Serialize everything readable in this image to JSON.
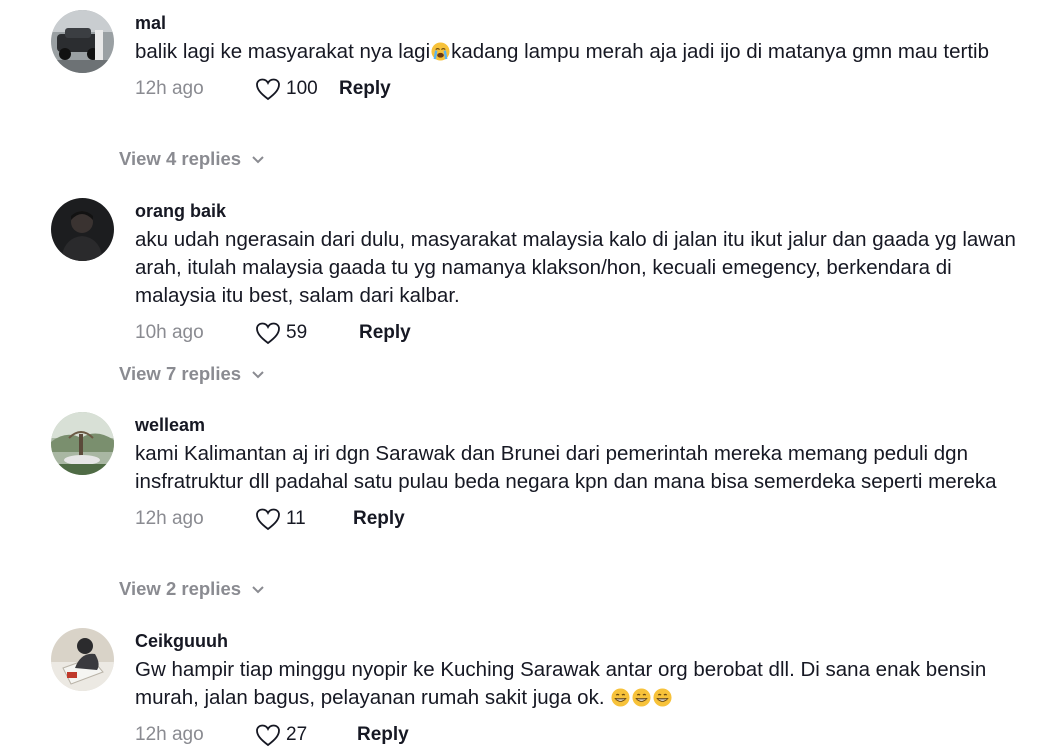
{
  "comments": [
    {
      "username": "mal",
      "text_before": "balik lagi ke masyarakat nya lagi",
      "emoji_inline": "loudly-crying-face",
      "text_after": "kadang lampu merah aja jadi ijo di matanya gmn mau tertib",
      "time": "12h ago",
      "likes": "100",
      "reply_label": "Reply",
      "view_replies": "View 4 replies"
    },
    {
      "username": "orang baik",
      "text": "aku udah ngerasain dari dulu, masyarakat malaysia kalo di jalan itu ikut jalur dan gaada yg lawan arah, itulah malaysia gaada tu yg namanya klakson/hon, kecuali emegency, berkendara di malaysia itu best, salam dari kalbar.",
      "time": "10h ago",
      "likes": "59",
      "reply_label": "Reply",
      "view_replies": "View 7 replies"
    },
    {
      "username": "welleam",
      "text": "kami Kalimantan aj iri dgn Sarawak dan Brunei dari pemerintah mereka memang peduli dgn insfratruktur dll padahal satu pulau beda negara kpn dan mana bisa semerdeka seperti mereka",
      "time": "12h ago",
      "likes": "11",
      "reply_label": "Reply",
      "view_replies": "View 2 replies"
    },
    {
      "username": "Ceikguuuh",
      "text": "Gw hampir tiap minggu nyopir ke Kuching Sarawak antar org berobat dll. Di sana enak bensin murah, jalan bagus, pelayanan rumah sakit juga ok.",
      "emoji_trailing": "grinning-face-x3",
      "time": "12h ago",
      "likes": "27",
      "reply_label": "Reply"
    }
  ],
  "colors": {
    "primary_text": "#161823",
    "secondary_text": "#8a8b91"
  }
}
